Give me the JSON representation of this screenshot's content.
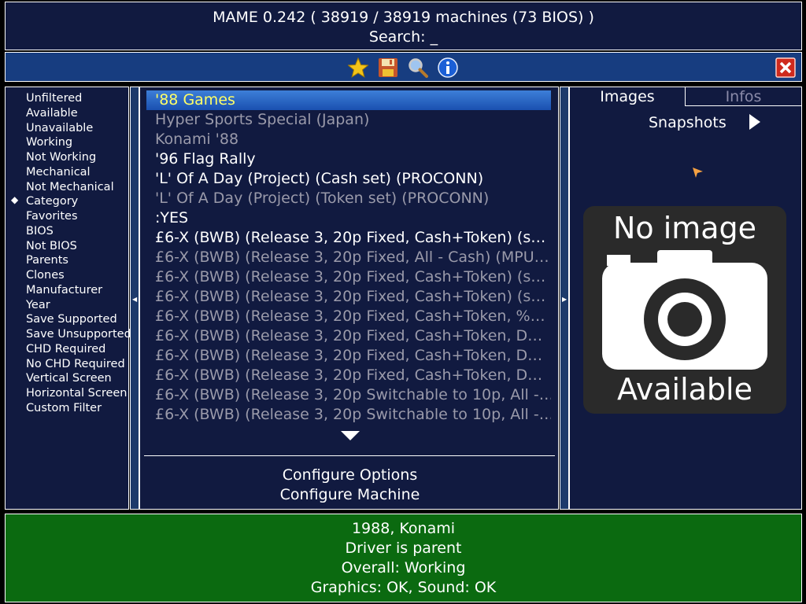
{
  "header": {
    "title": "MAME 0.242 ( 38919 / 38919 machines (73 BIOS) )",
    "search": "Search: _"
  },
  "toolbar": {
    "icons": [
      "star-icon",
      "floppy-disk-icon",
      "magnifier-icon",
      "info-icon"
    ],
    "close": "close-icon"
  },
  "filters": {
    "active_index": 7,
    "items": [
      "Unfiltered",
      "Available",
      "Unavailable",
      "Working",
      "Not Working",
      "Mechanical",
      "Not Mechanical",
      "Category",
      "Favorites",
      "BIOS",
      "Not BIOS",
      "Parents",
      "Clones",
      "Manufacturer",
      "Year",
      "Save Supported",
      "Save Unsupported",
      "CHD Required",
      "No CHD Required",
      "Vertical Screen",
      "Horizontal Screen",
      "Custom Filter"
    ]
  },
  "list": {
    "items": [
      {
        "label": "'88 Games",
        "state": "sel"
      },
      {
        "label": "Hyper Sports Special (Japan)",
        "state": "unavail"
      },
      {
        "label": "Konami '88",
        "state": "unavail"
      },
      {
        "label": "'96 Flag Rally",
        "state": "avail"
      },
      {
        "label": "'L' Of A Day (Project) (Cash set) (PROCONN)",
        "state": "avail"
      },
      {
        "label": "'L' Of A Day (Project) (Token set) (PROCONN)",
        "state": "unavail"
      },
      {
        "label": ":YES",
        "state": "avail"
      },
      {
        "label": "£6-X (BWB) (Release 3, 20p Fixed, Cash+Token) (s…",
        "state": "avail"
      },
      {
        "label": "£6-X (BWB) (Release 3, 20p Fixed, All - Cash) (MPU…",
        "state": "unavail"
      },
      {
        "label": "£6-X (BWB) (Release 3, 20p Fixed, Cash+Token) (s…",
        "state": "unavail"
      },
      {
        "label": "£6-X (BWB) (Release 3, 20p Fixed, Cash+Token) (s…",
        "state": "unavail"
      },
      {
        "label": "£6-X (BWB) (Release 3, 20p Fixed, Cash+Token, %…",
        "state": "unavail"
      },
      {
        "label": "£6-X (BWB) (Release 3, 20p Fixed, Cash+Token, D…",
        "state": "unavail"
      },
      {
        "label": "£6-X (BWB) (Release 3, 20p Fixed, Cash+Token, D…",
        "state": "unavail"
      },
      {
        "label": "£6-X (BWB) (Release 3, 20p Fixed, Cash+Token, D…",
        "state": "unavail"
      },
      {
        "label": "£6-X (BWB) (Release 3, 20p Switchable to 10p, All -…",
        "state": "unavail"
      },
      {
        "label": "£6-X (BWB) (Release 3, 20p Switchable to 10p, All -…",
        "state": "unavail"
      }
    ]
  },
  "config": {
    "options": "Configure Options",
    "machine": "Configure Machine"
  },
  "right": {
    "tab_images": "Images",
    "tab_infos": "Infos",
    "snapshots": "Snapshots",
    "noimage_top": "No image",
    "noimage_bottom": "Available"
  },
  "footer": {
    "lines": [
      "1988, Konami",
      "Driver is parent",
      "Overall: Working",
      "Graphics: OK, Sound: OK"
    ]
  },
  "colors": {
    "panel": "#111a40",
    "toolbar": "#173d80",
    "footer": "#0b6a10",
    "selected_text": "#ffff66",
    "unavailable_text": "#9a9aaa"
  }
}
